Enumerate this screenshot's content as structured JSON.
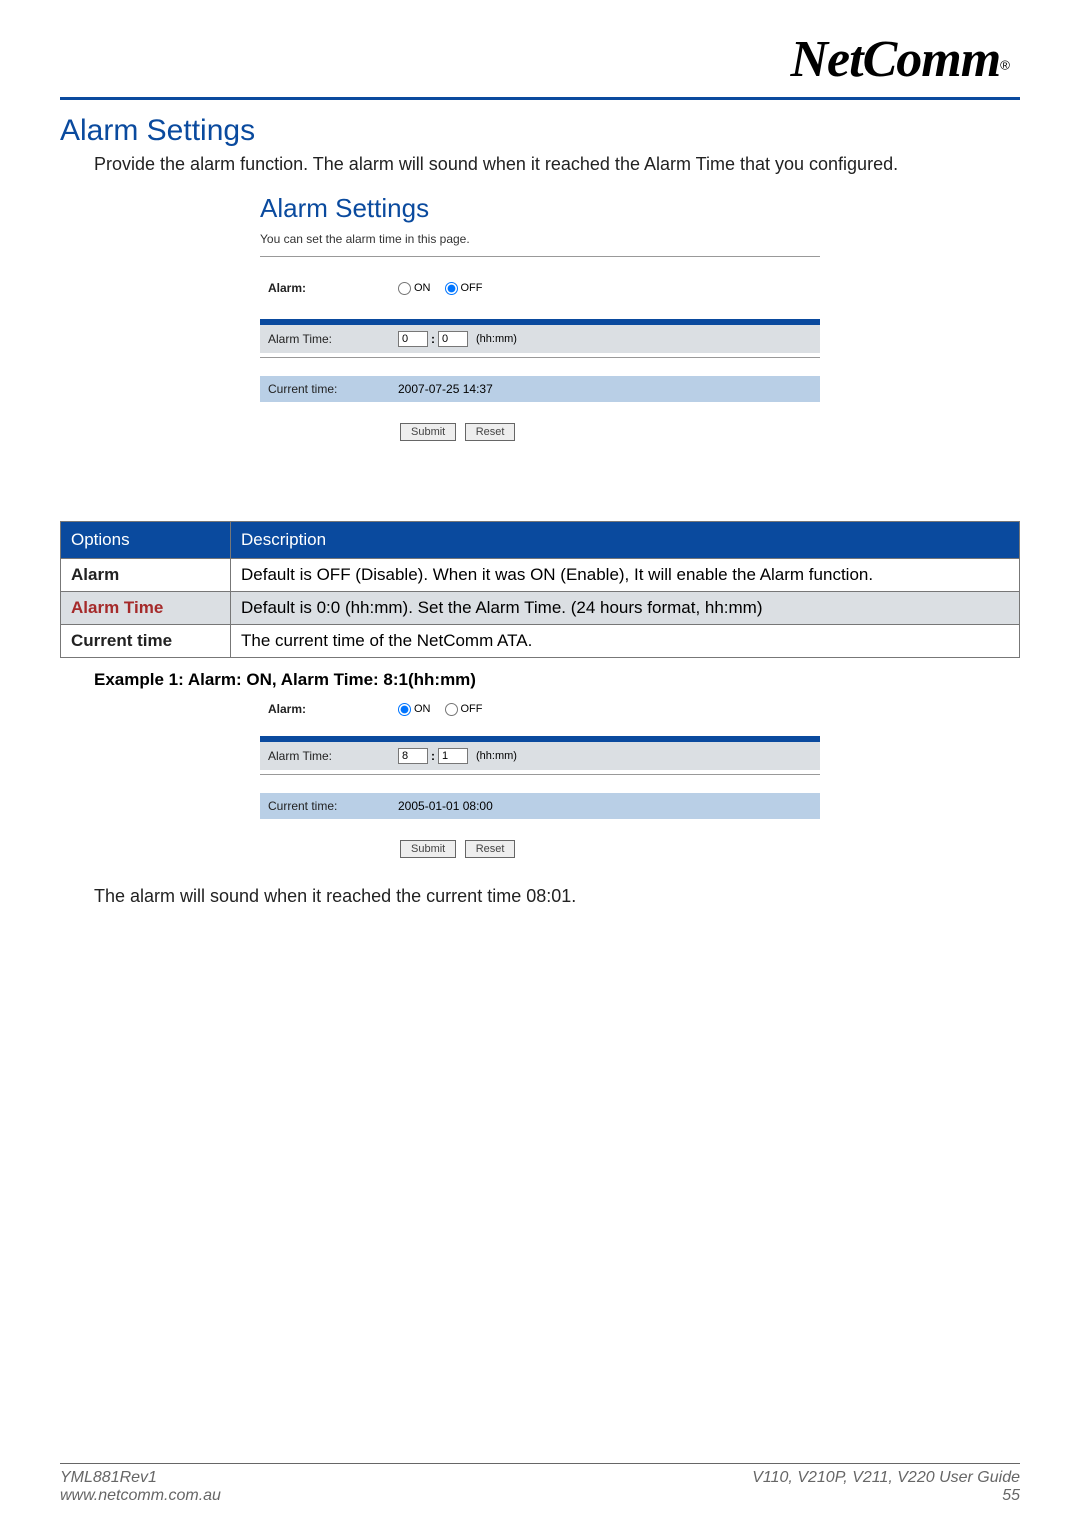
{
  "header": {
    "brand": "NetComm",
    "reg": "®"
  },
  "section": {
    "title": "Alarm Settings",
    "intro": "Provide the alarm function. The alarm will sound when it reached the Alarm Time that you configured."
  },
  "panel1": {
    "title": "Alarm Settings",
    "subtitle": "You can set the alarm time in this page.",
    "alarm_label": "Alarm:",
    "on_label": "ON",
    "off_label": "OFF",
    "alarm_on": false,
    "alarm_time_label": "Alarm Time:",
    "hh": "0",
    "mm": "0",
    "hhmm_text": "(hh:mm)",
    "current_time_label": "Current time:",
    "current_time_value": "2007-07-25 14:37",
    "submit": "Submit",
    "reset": "Reset"
  },
  "options_table": {
    "head_options": "Options",
    "head_desc": "Description",
    "rows": [
      {
        "opt": "Alarm",
        "desc": "Default is OFF (Disable). When it was ON (Enable), It will enable the Alarm function."
      },
      {
        "opt": "Alarm Time",
        "desc": "Default is 0:0 (hh:mm). Set the Alarm Time. (24 hours format, hh:mm)"
      },
      {
        "opt": "Current time",
        "desc": "The current time of the NetComm ATA."
      }
    ]
  },
  "example": {
    "title": "Example 1: Alarm: ON, Alarm Time: 8:1(hh:mm)",
    "alarm_label": "Alarm:",
    "on_label": "ON",
    "off_label": "OFF",
    "alarm_on": true,
    "alarm_time_label": "Alarm Time:",
    "hh": "8",
    "mm": "1",
    "hhmm_text": "(hh:mm)",
    "current_time_label": "Current time:",
    "current_time_value": "2005-01-01 08:00",
    "submit": "Submit",
    "reset": "Reset",
    "result": "The alarm will sound when it reached the current time 08:01."
  },
  "footer": {
    "left1": "YML881Rev1",
    "left2": "www.netcomm.com.au",
    "right1": "V110, V210P, V211, V220 User Guide",
    "right2": "55"
  }
}
